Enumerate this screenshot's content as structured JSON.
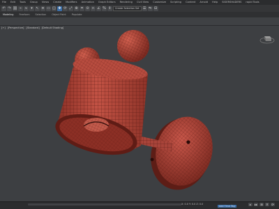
{
  "menu": {
    "items": [
      "File",
      "Edit",
      "Tools",
      "Group",
      "Views",
      "Create",
      "Modifiers",
      "Animation",
      "Graph Editors",
      "Rendering",
      "Civil View",
      "Customize",
      "Scripting",
      "Content",
      "Arnold",
      "Help",
      "SIGERSHADERS",
      "rapid Tools"
    ]
  },
  "toolbar": {
    "buttons": [
      "undo-icon",
      "redo-icon",
      "link-icon",
      "unlink-icon",
      "bind-icon",
      "select-filter-icon",
      "select-icon",
      "select-name-icon",
      "rect-select-icon",
      "window-crossing-icon",
      "move-icon",
      "rotate-icon",
      "scale-icon",
      "placement-icon",
      "ref-coord-icon",
      "pivot-icon",
      "snap-icon",
      "angle-snap-icon",
      "percent-snap-icon",
      "spinner-snap-icon",
      "selection-set-icon",
      "mirror-icon",
      "align-icon"
    ],
    "selection_set": "Create Selection Set",
    "view_dropdown": "View"
  },
  "ribbon": {
    "tabs": [
      "Modeling",
      "Freeform",
      "Selection",
      "Object Paint",
      "Populate"
    ]
  },
  "viewport": {
    "label_parts": [
      "[+]",
      "[Perspective]",
      "[Standard]",
      "[Default Shading]"
    ]
  },
  "status": {
    "frame_counter": "0 / 100",
    "coords": "X: 0.0  Y: 0.0  Z: 0.0",
    "autokey": "Add Time Tag",
    "setkey": "Set Key"
  },
  "colors": {
    "mesh": "#b5463a",
    "mesh_dark": "#6e221b",
    "wire": "#4a130f",
    "viewport_bg": "#3d3f42"
  }
}
